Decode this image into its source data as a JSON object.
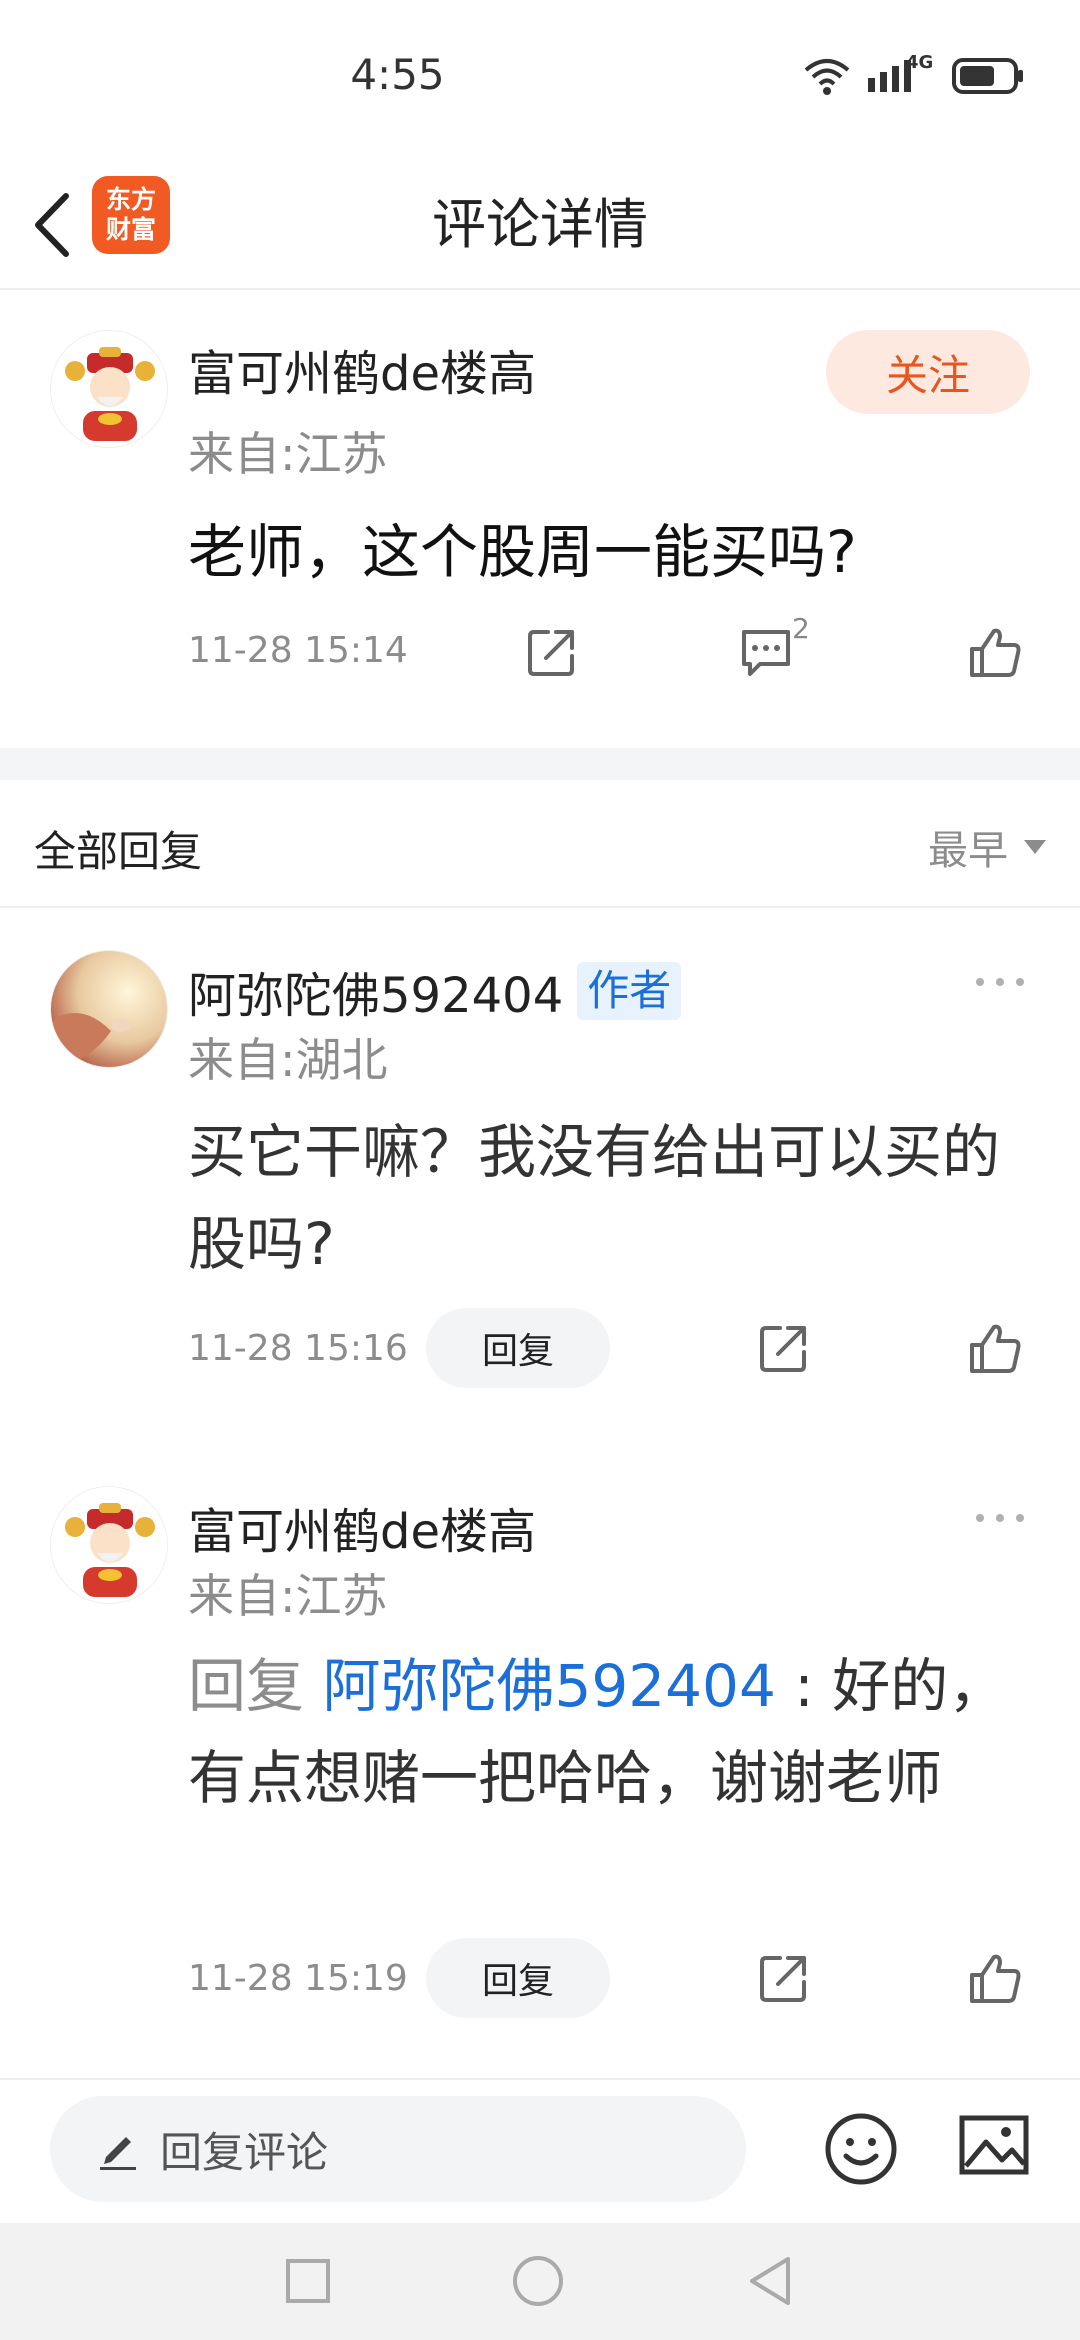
{
  "status_bar": {
    "time": "4:55",
    "network": "4G"
  },
  "header": {
    "title": "评论详情",
    "logo_text": "东方财富"
  },
  "main_comment": {
    "username": "富可州鹤de楼高",
    "location": "来自:江苏",
    "text": "老师，这个股周一能买吗?",
    "timestamp": "11-28 15:14",
    "reply_count": "2",
    "follow_label": "关注"
  },
  "replies_section": {
    "title": "全部回复",
    "sort_label": "最早"
  },
  "replies": [
    {
      "username": "阿弥陀佛592404",
      "badge": "作者",
      "location": "来自:湖北",
      "text": "买它干嘛？我没有给出可以买的股吗?",
      "timestamp": "11-28 15:16",
      "reply_label": "回复"
    },
    {
      "username": "富可州鹤de楼高",
      "location": "来自:江苏",
      "reply_prefix": "回复 ",
      "reply_target": "阿弥陀佛592404",
      "text": " : 好的，有点想赌一把哈哈，谢谢老师",
      "timestamp": "11-28 15:19",
      "reply_label": "回复"
    }
  ],
  "bottom_bar": {
    "input_placeholder": "回复评论"
  },
  "colors": {
    "brand": "#f15a22",
    "link": "#1a6fd8",
    "follow_text": "#e8561f"
  }
}
